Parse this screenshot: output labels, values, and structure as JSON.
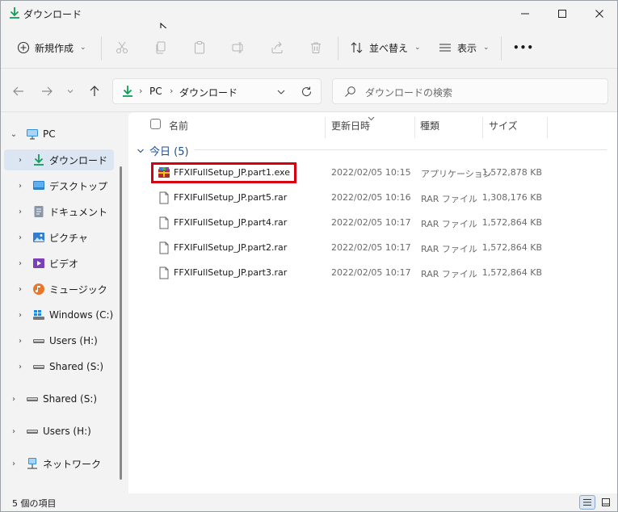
{
  "window": {
    "title": "ダウンロード"
  },
  "toolbar": {
    "new_label": "新規作成",
    "sort_label": "並べ替え",
    "view_label": "表示",
    "more_label": "•••"
  },
  "address": {
    "crumbs": [
      "PC",
      "ダウンロード"
    ]
  },
  "search": {
    "placeholder": "ダウンロードの検索"
  },
  "nav": {
    "items": [
      {
        "label": "PC",
        "icon": "pc-icon"
      },
      {
        "label": "ダウンロード",
        "icon": "download-icon",
        "selected": true
      },
      {
        "label": "デスクトップ",
        "icon": "desktop-icon"
      },
      {
        "label": "ドキュメント",
        "icon": "document-icon"
      },
      {
        "label": "ピクチャ",
        "icon": "picture-icon"
      },
      {
        "label": "ビデオ",
        "icon": "video-icon"
      },
      {
        "label": "ミュージック",
        "icon": "music-icon"
      },
      {
        "label": "Windows (C:)",
        "icon": "windows-drive-icon"
      },
      {
        "label": "Users (H:)",
        "icon": "drive-icon"
      },
      {
        "label": "Shared (S:)",
        "icon": "drive-icon"
      },
      {
        "label": "Shared (S:)",
        "icon": "drive-icon"
      },
      {
        "label": "Users (H:)",
        "icon": "drive-icon"
      },
      {
        "label": "ネットワーク",
        "icon": "network-icon"
      }
    ]
  },
  "columns": {
    "name": "名前",
    "date": "更新日時",
    "type": "種類",
    "size": "サイズ"
  },
  "group": {
    "label": "今日 (5)"
  },
  "files": [
    {
      "name": "FFXIFullSetup_JP.part1.exe",
      "date": "2022/02/05 10:15",
      "type": "アプリケーション",
      "size": "1,572,878 KB",
      "icon": "exe-archive-icon"
    },
    {
      "name": "FFXIFullSetup_JP.part5.rar",
      "date": "2022/02/05 10:16",
      "type": "RAR ファイル",
      "size": "1,308,176 KB",
      "icon": "file-icon"
    },
    {
      "name": "FFXIFullSetup_JP.part4.rar",
      "date": "2022/02/05 10:17",
      "type": "RAR ファイル",
      "size": "1,572,864 KB",
      "icon": "file-icon"
    },
    {
      "name": "FFXIFullSetup_JP.part2.rar",
      "date": "2022/02/05 10:17",
      "type": "RAR ファイル",
      "size": "1,572,864 KB",
      "icon": "file-icon"
    },
    {
      "name": "FFXIFullSetup_JP.part3.rar",
      "date": "2022/02/05 10:17",
      "type": "RAR ファイル",
      "size": "1,572,864 KB",
      "icon": "file-icon"
    }
  ],
  "status": {
    "item_count": "5 個の項目"
  },
  "colors": {
    "accent": "#1f4e8c",
    "selection": "#dce6f3",
    "highlight_border": "#d7000f",
    "download_green": "#0f9d58"
  }
}
